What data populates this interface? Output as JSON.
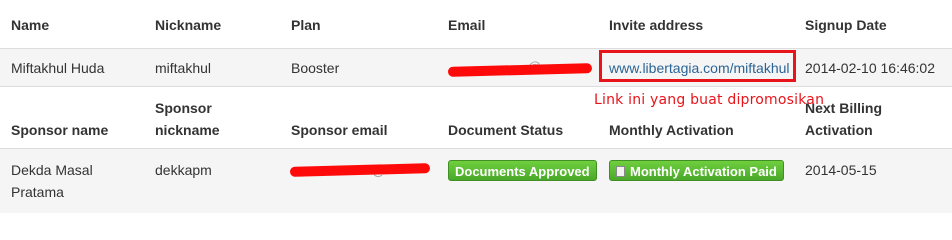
{
  "headers_top": [
    "Name",
    "Nickname",
    "Plan",
    "Email",
    "Invite address",
    "Signup Date"
  ],
  "user": {
    "name": "Miftakhul Huda",
    "nickname": "miftakhul",
    "plan": "Booster",
    "email_redacted_visible": "@",
    "invite_address": "www.libertagia.com/miftakhul",
    "signup_date": "2014-02-10 16:46:02"
  },
  "annotation": "Link ini yang buat dipromosikan",
  "headers_bottom": {
    "sponsor_name": "Sponsor name",
    "sponsor_nickname_line1": "Sponsor",
    "sponsor_nickname_line2": "nickname",
    "sponsor_email": "Sponsor email",
    "document_status": "Document Status",
    "monthly_activation": "Monthly Activation",
    "next_billing_line1": "Next Billing",
    "next_billing_line2": "Activation"
  },
  "sponsor": {
    "name_line1": "Dekda Masal",
    "name_line2": "Pratama",
    "nickname": "dekkapm",
    "email_redacted_visible": "@",
    "document_status": "Documents Approved",
    "monthly_activation": "Monthly Activation Paid",
    "next_billing": "2014-05-15"
  },
  "colors": {
    "annotation_red": "#e8141b",
    "badge_green": "#4aa82a",
    "link_blue": "#2a6496"
  }
}
